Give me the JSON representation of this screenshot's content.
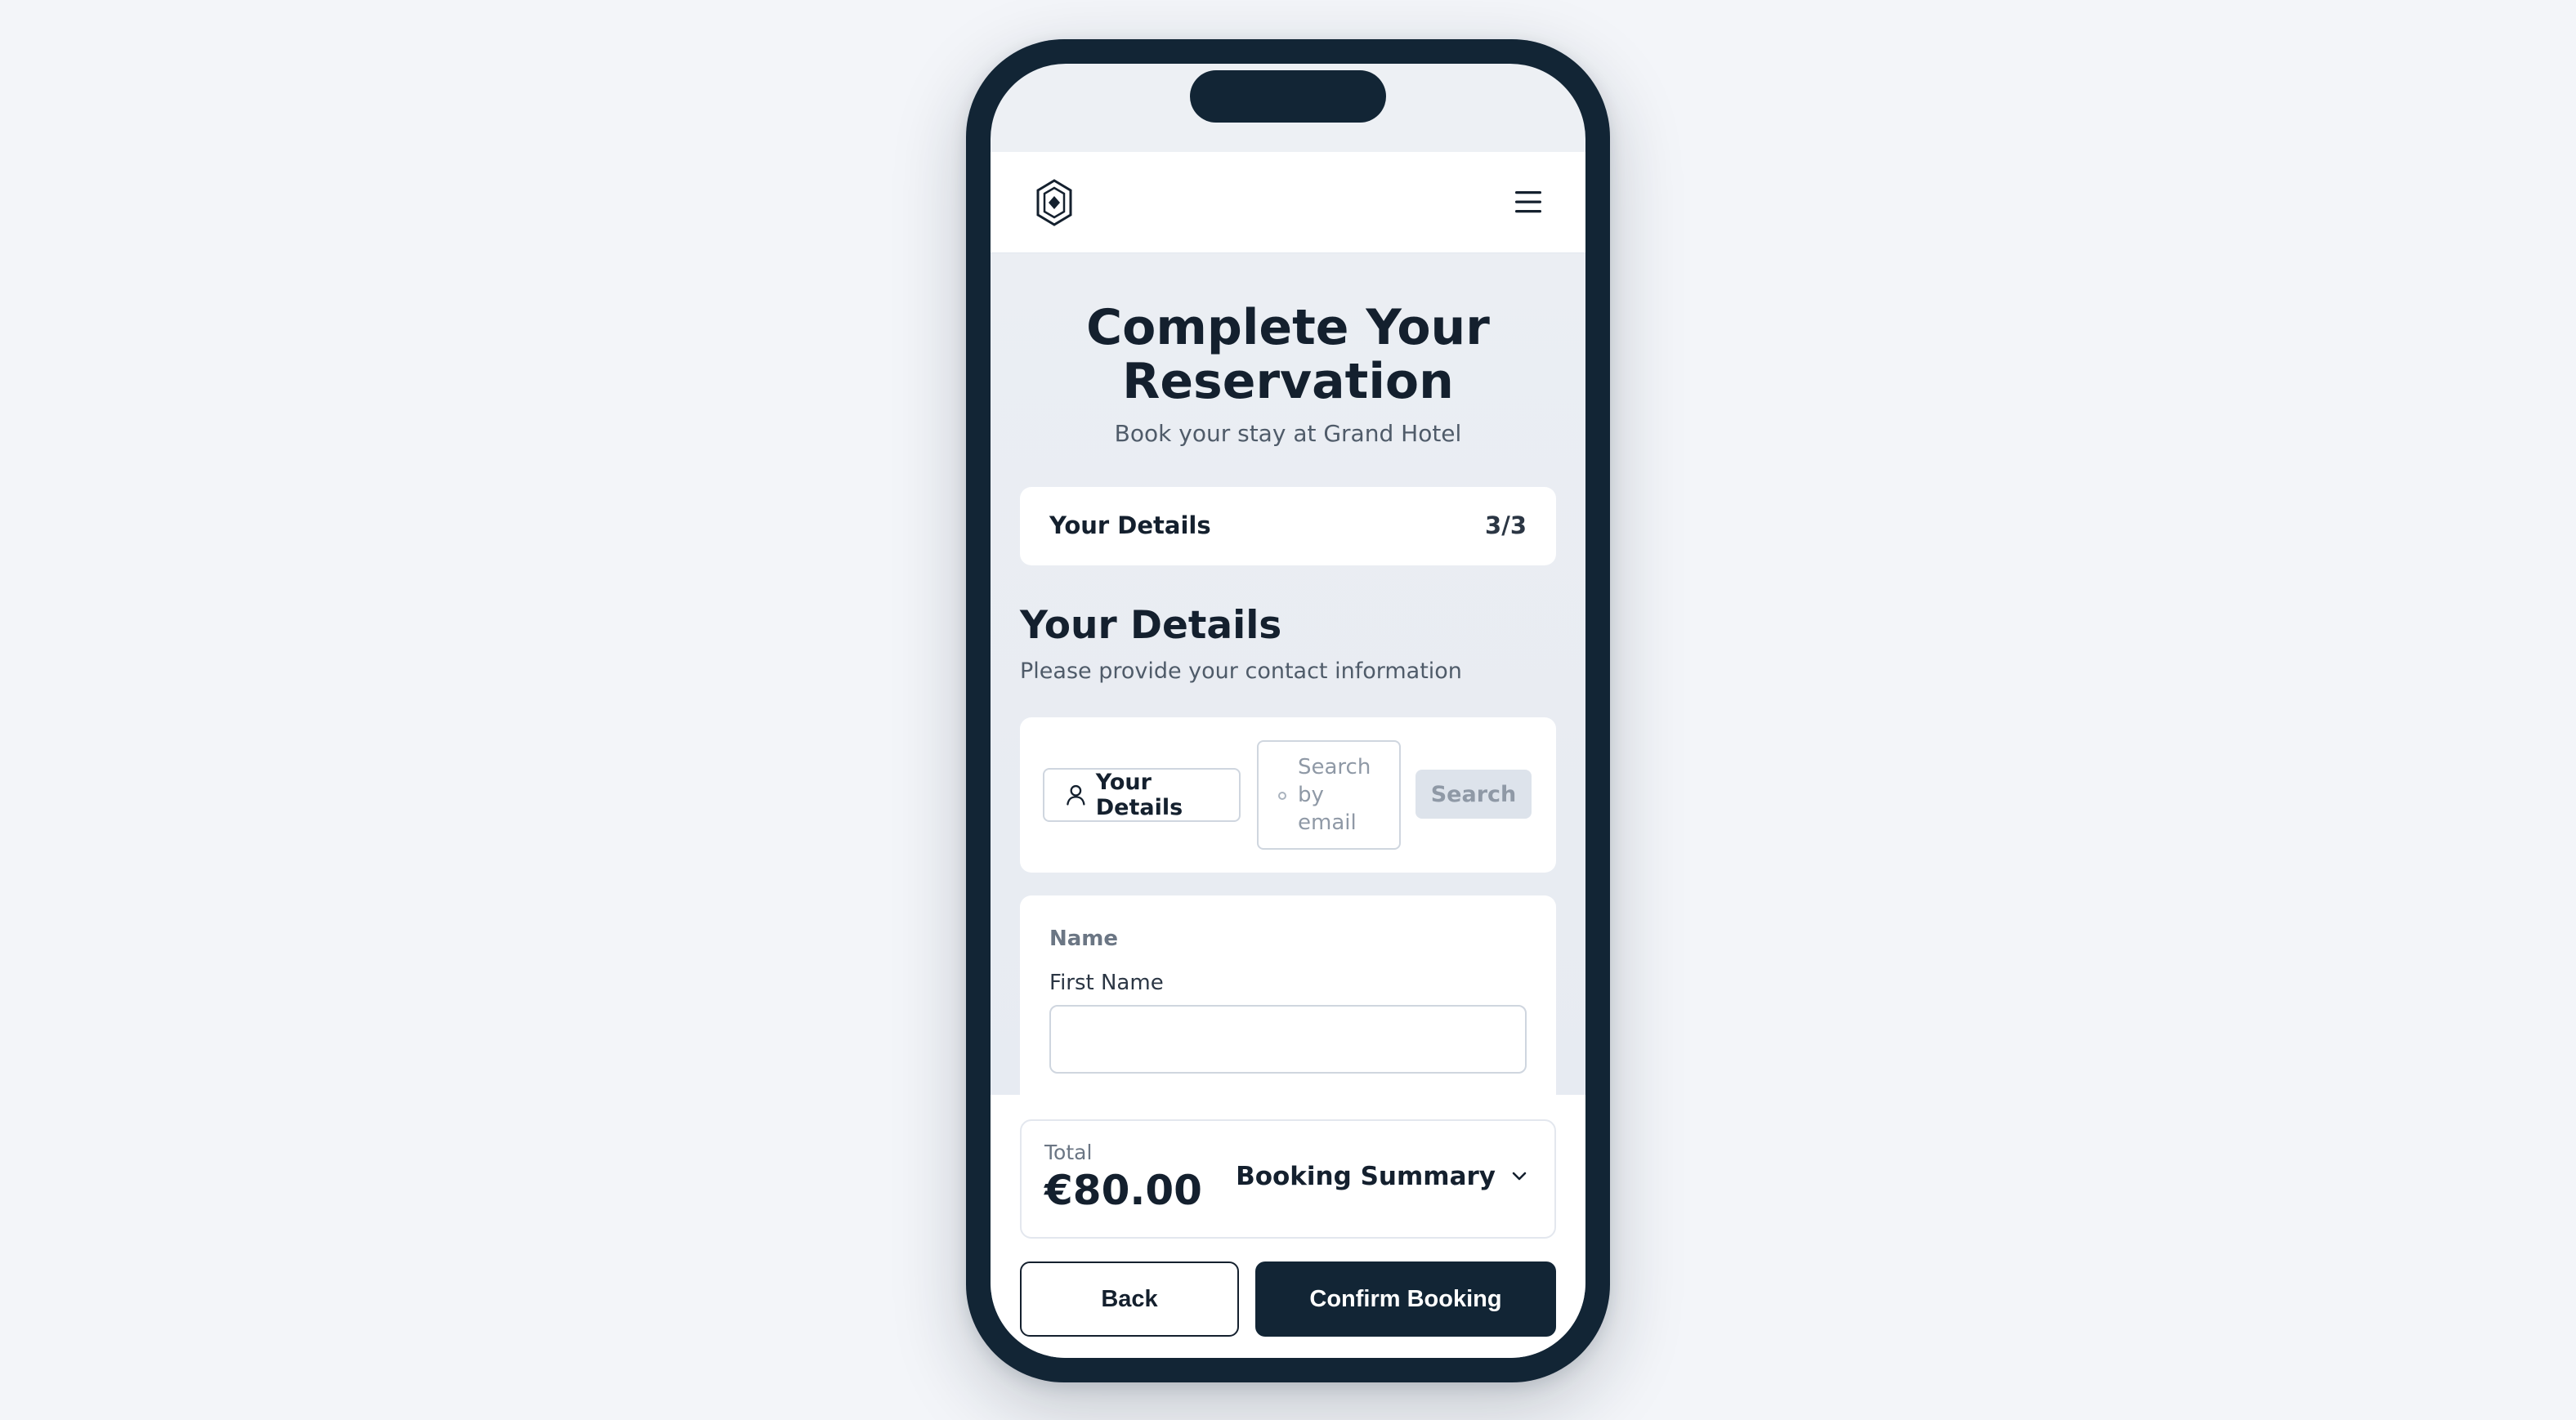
{
  "header": {
    "logo_icon": "hexagon-logo-icon",
    "menu_icon": "hamburger-menu-icon"
  },
  "page": {
    "title_line1": "Complete Your",
    "title_line2": "Reservation",
    "subtitle": "Book your stay at Grand Hotel"
  },
  "progress": {
    "step_label": "Your Details",
    "step_count": "3/3"
  },
  "section": {
    "title": "Your Details",
    "subtitle": "Please provide your contact information"
  },
  "lookup": {
    "details_button_label": "Your Details",
    "details_icon": "user-icon",
    "search_placeholder": "Search by email",
    "search_value": "",
    "search_button_label": "Search"
  },
  "name_form": {
    "group_label": "Name",
    "first_name_label": "First Name",
    "first_name_value": ""
  },
  "footer": {
    "total_label": "Total",
    "total_value": "€80.00",
    "summary_toggle_label": "Booking Summary",
    "summary_toggle_icon": "chevron-down-icon",
    "back_label": "Back",
    "confirm_label": "Confirm Booking"
  },
  "colors": {
    "page_background": "#f3f5f9",
    "phone_frame": "#122535",
    "primary_button": "#122535",
    "disabled_button": "#dde3eb"
  }
}
